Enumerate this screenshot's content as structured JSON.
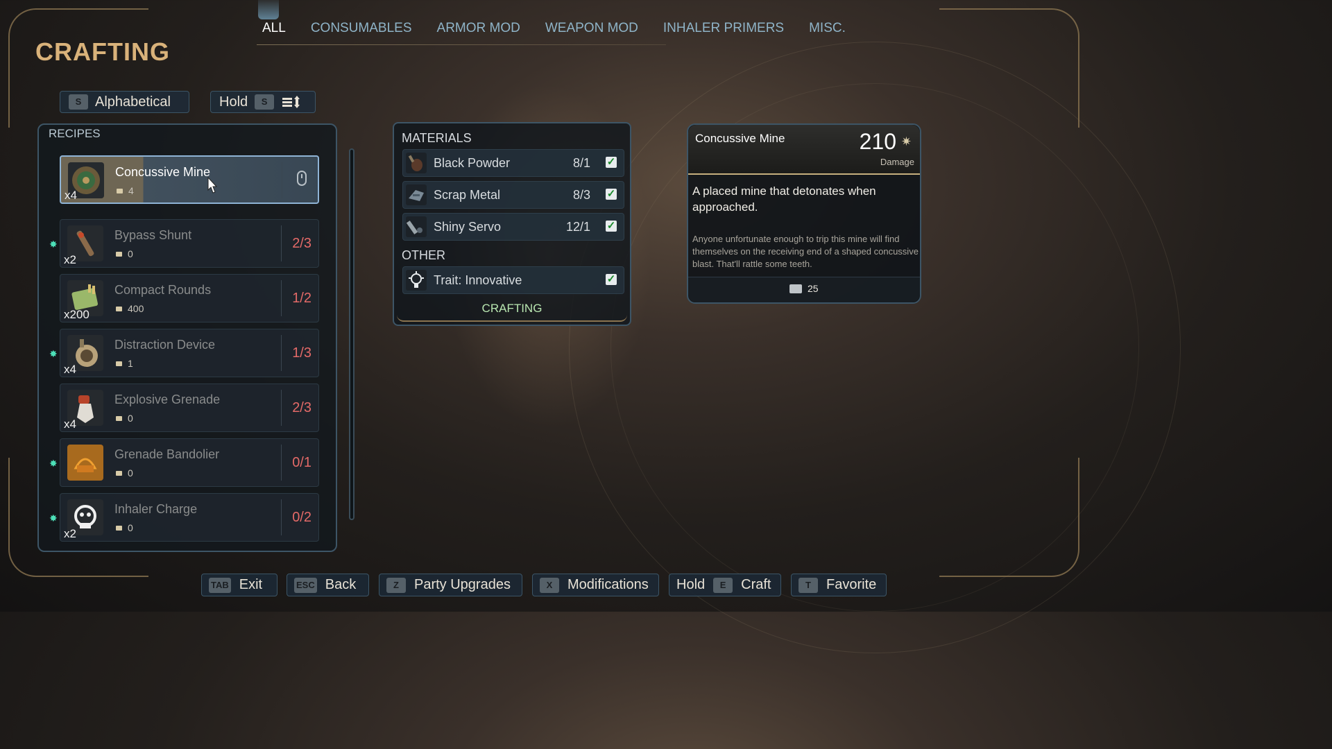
{
  "tabs": [
    "ALL",
    "CONSUMABLES",
    "ARMOR MOD",
    "WEAPON MOD",
    "INHALER PRIMERS",
    "MISC."
  ],
  "title": "CRAFTING",
  "sort": {
    "key": "S",
    "label": "Alphabetical",
    "hold_label": "Hold",
    "hold_key": "S"
  },
  "recipes_label": "RECIPES",
  "recipes": [
    {
      "name": "Concussive Mine",
      "qty": "x4",
      "owned": "4",
      "count": ""
    },
    {
      "name": "Bypass Shunt",
      "qty": "x2",
      "owned": "0",
      "count": "2/3"
    },
    {
      "name": "Compact Rounds",
      "qty": "x200",
      "owned": "400",
      "count": "1/2"
    },
    {
      "name": "Distraction Device",
      "qty": "x4",
      "owned": "1",
      "count": "1/3"
    },
    {
      "name": "Explosive Grenade",
      "qty": "x4",
      "owned": "0",
      "count": "2/3"
    },
    {
      "name": "Grenade Bandolier",
      "qty": "",
      "owned": "0",
      "count": "0/1"
    },
    {
      "name": "Inhaler Charge",
      "qty": "x2",
      "owned": "0",
      "count": "0/2"
    }
  ],
  "materials_label": "MATERIALS",
  "materials": [
    {
      "name": "Black Powder",
      "count": "8/1"
    },
    {
      "name": "Scrap Metal",
      "count": "8/3"
    },
    {
      "name": "Shiny Servo",
      "count": "12/1"
    }
  ],
  "other_label": "OTHER",
  "other": [
    {
      "name": "Trait: Innovative"
    }
  ],
  "crafting_label": "CRAFTING",
  "detail": {
    "name": "Concussive Mine",
    "value": "210",
    "unit": "Damage",
    "description": "A placed mine that detonates when approached.",
    "lore": "Anyone unfortunate enough to trip this mine will find themselves on the receiving end of a shaped concussive blast. That'll rattle some teeth.",
    "price": "25"
  },
  "bottom": [
    {
      "key": "TAB",
      "label": "Exit"
    },
    {
      "key": "ESC",
      "label": "Back"
    },
    {
      "key": "Z",
      "label": "Party Upgrades"
    },
    {
      "key": "X",
      "label": "Modifications"
    },
    {
      "prefix": "Hold",
      "key": "E",
      "label": "Craft"
    },
    {
      "key": "T",
      "label": "Favorite"
    }
  ],
  "colors": {
    "accent_gold": "#d9b27a",
    "tab_blue": "#8fb4c8",
    "count_red": "#e46a68",
    "new_dot": "#4de0b8",
    "check_green": "#1a8a2c"
  }
}
